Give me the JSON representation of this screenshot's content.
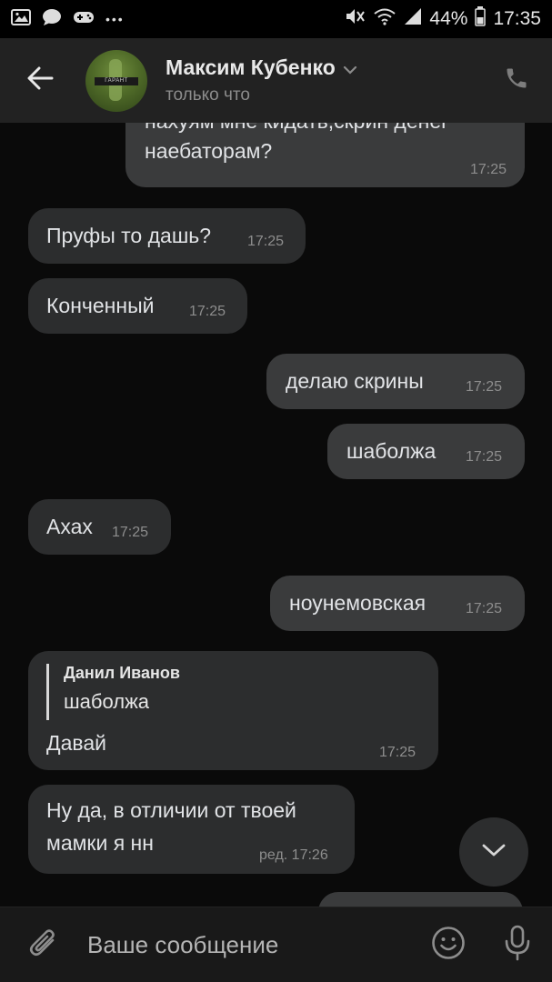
{
  "status_bar": {
    "battery": "44%",
    "time": "17:35",
    "more_icon": "•••",
    "icons_left": [
      "gallery-icon",
      "chat-icon",
      "gamepad-icon",
      "more-icon"
    ],
    "icons_right": [
      "mute-icon",
      "wifi-icon",
      "signal-icon",
      "battery-icon"
    ]
  },
  "header": {
    "contact_name": "Максим Кубенко",
    "status": "только что",
    "avatar_band_text": "ГАРАНТ"
  },
  "messages": [
    {
      "direction": "out",
      "text": "нахуям мне кидать,скрин денег наебаторам?",
      "line1": "нахуям мне кидать,скрин денег",
      "line2": "наебаторам?",
      "time": "17:25"
    },
    {
      "direction": "in",
      "text": "Пруфы то дашь?",
      "time": "17:25"
    },
    {
      "direction": "in",
      "text": "Конченный",
      "time": "17:25"
    },
    {
      "direction": "out",
      "text": "делаю скрины",
      "time": "17:25"
    },
    {
      "direction": "out",
      "text": "шаболжа",
      "time": "17:25"
    },
    {
      "direction": "in",
      "text": "Ахах",
      "time": "17:25"
    },
    {
      "direction": "out",
      "text": "ноунемовская",
      "time": "17:25"
    },
    {
      "direction": "in",
      "reply_author": "Данил Иванов",
      "reply_text": "шаболжа",
      "text": "Давай",
      "time": "17:25"
    },
    {
      "direction": "in",
      "line1": "Ну да, в отличии от твоей",
      "line2": "мамки я нн",
      "time": "ред. 17:26"
    }
  ],
  "composer": {
    "placeholder": "Ваше сообщение"
  },
  "colors": {
    "header_bg": "#222222",
    "chat_bg": "#0a0a0a",
    "incoming_bubble": "#2c2d2e",
    "outgoing_bubble": "#3a3b3c",
    "composer_bg": "#191919"
  }
}
